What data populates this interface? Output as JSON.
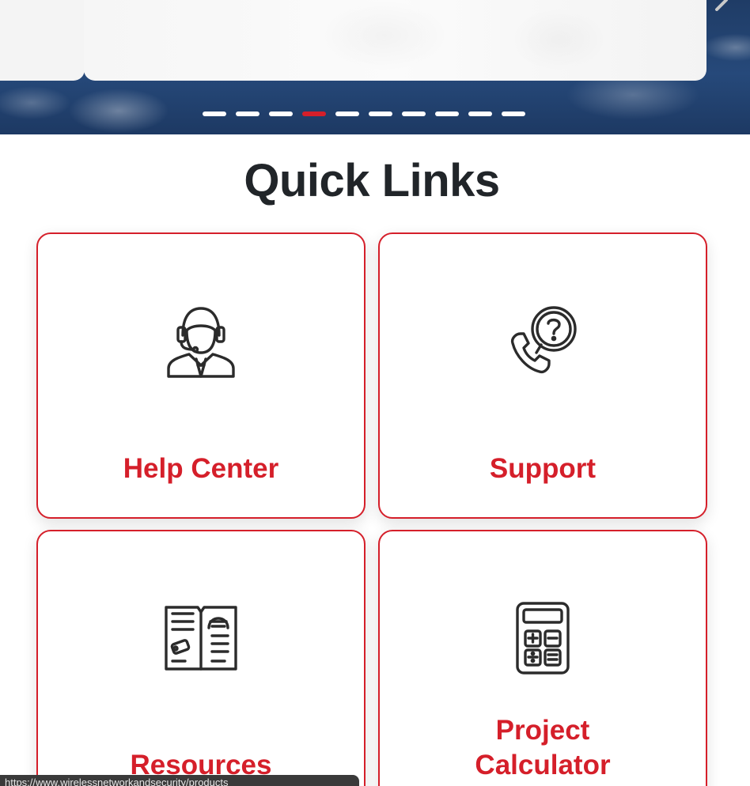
{
  "carousel": {
    "slide_count": 10,
    "active_index": 3,
    "active_color": "#d51f2a",
    "inactive_color": "#ffffff"
  },
  "quick_links": {
    "title": "Quick Links",
    "accent_color": "#d51f2a",
    "items": [
      {
        "label": "Help Center",
        "icon": "customer-service-agent-icon"
      },
      {
        "label": "Support",
        "icon": "phone-question-icon"
      },
      {
        "label": "Resources",
        "icon": "open-book-icon"
      },
      {
        "label": "Project\nCalculator",
        "icon": "calculator-icon"
      }
    ]
  },
  "status_bar": {
    "url_text": "https://www.wirelessnetworkandsecurity/products"
  }
}
